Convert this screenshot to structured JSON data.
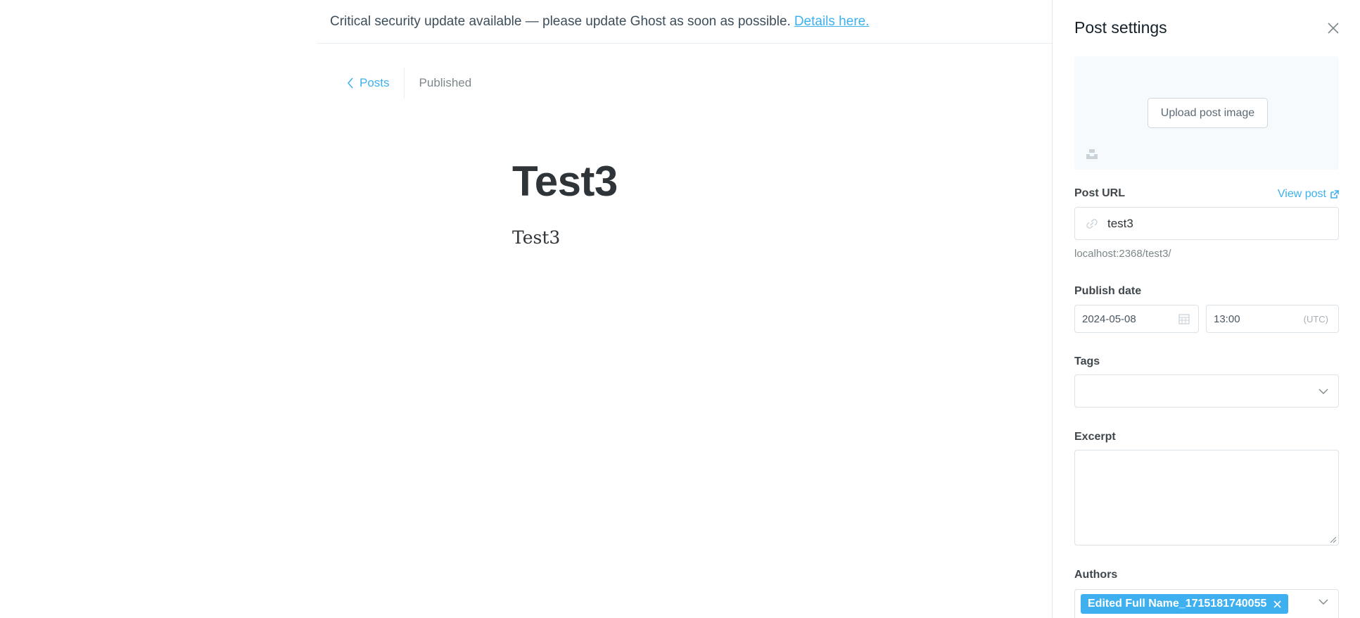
{
  "banner": {
    "message": "Critical security update available — please update Ghost as soon as possible.",
    "link_text": "Details here."
  },
  "breadcrumb": {
    "back_label": "Posts",
    "status": "Published"
  },
  "post": {
    "title": "Test3",
    "body": "Test3"
  },
  "settings": {
    "title": "Post settings",
    "upload_image_label": "Upload post image",
    "post_url_label": "Post URL",
    "view_post_label": "View post",
    "slug_value": "test3",
    "url_preview": "localhost:2368/test3/",
    "publish_date_label": "Publish date",
    "date_value": "2024-05-08",
    "time_value": "13:00",
    "timezone": "(UTC)",
    "tags_label": "Tags",
    "excerpt_label": "Excerpt",
    "excerpt_value": "",
    "authors_label": "Authors",
    "author_name": "Edited Full Name_1715181740055"
  },
  "colors": {
    "accent": "#3eb0ef",
    "text_dark": "#15212a",
    "muted": "#7d878a",
    "border": "#dbe3e8"
  },
  "icons": [
    "chevron-left-icon",
    "close-icon",
    "unsplash-icon",
    "external-link-icon",
    "link-icon",
    "calendar-icon",
    "chevron-down-icon",
    "remove-tag-icon",
    "resize-handle-icon"
  ]
}
